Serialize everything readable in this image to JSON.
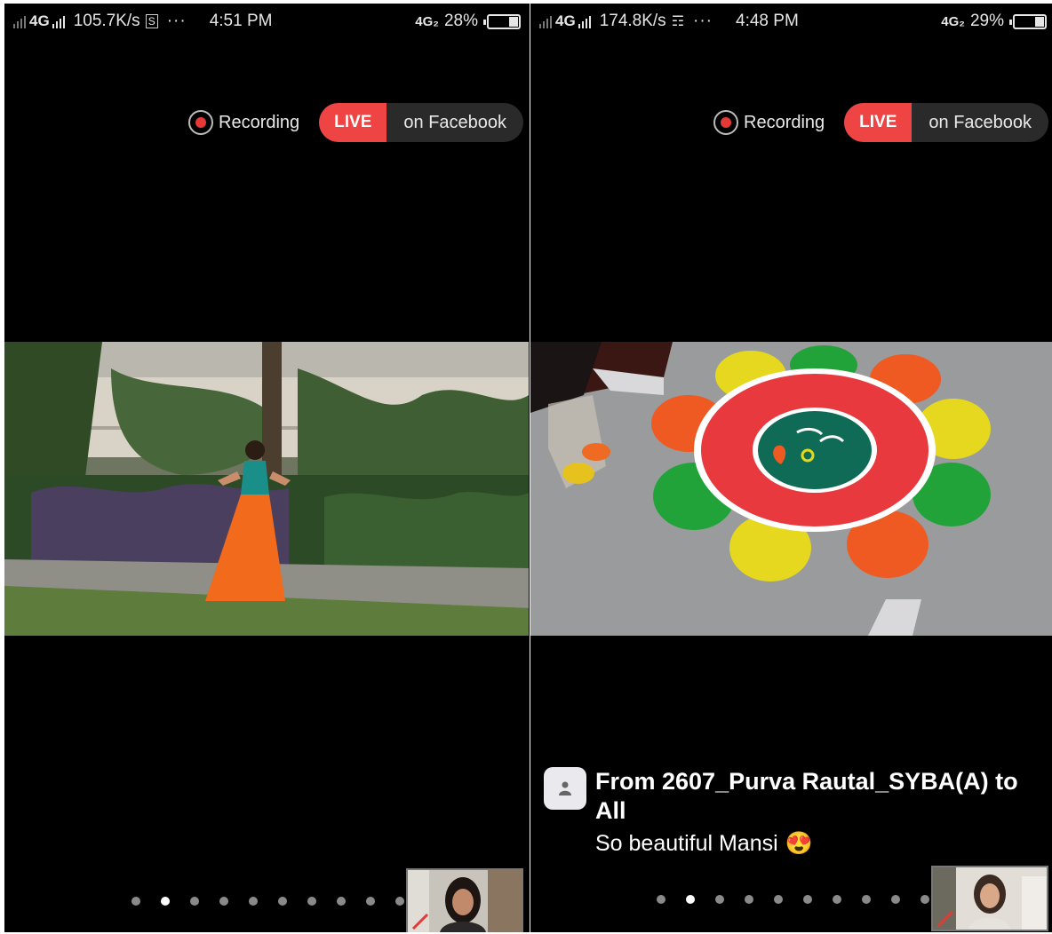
{
  "screens": [
    {
      "status_bar": {
        "network": "4G",
        "speed": "105.7K/s",
        "app_icon": "S",
        "more": "···",
        "time": "4:51 PM",
        "network_right": "4G₂",
        "battery": "28%",
        "battery_level": 0.28
      },
      "recording_label": "Recording",
      "live_label": "LIVE",
      "live_target": "on Facebook",
      "video_scene": "dancer-in-garden",
      "pagination": {
        "count": 10,
        "active_index": 1
      }
    },
    {
      "status_bar": {
        "network": "4G",
        "speed": "174.8K/s",
        "app_icon": "☶",
        "more": "···",
        "time": "4:48 PM",
        "network_right": "4G₂",
        "battery": "29%",
        "battery_level": 0.29
      },
      "recording_label": "Recording",
      "live_label": "LIVE",
      "live_target": "on Facebook",
      "video_scene": "rangoli-art",
      "chat": {
        "title": "From 2607_Purva Rautal_SYBA(A) to All",
        "message": "So beautiful Mansi",
        "emoji": "😍"
      },
      "pagination": {
        "count": 10,
        "active_index": 1
      }
    }
  ],
  "colors": {
    "live_red": "#ef4444",
    "recording_red": "#e53935"
  }
}
